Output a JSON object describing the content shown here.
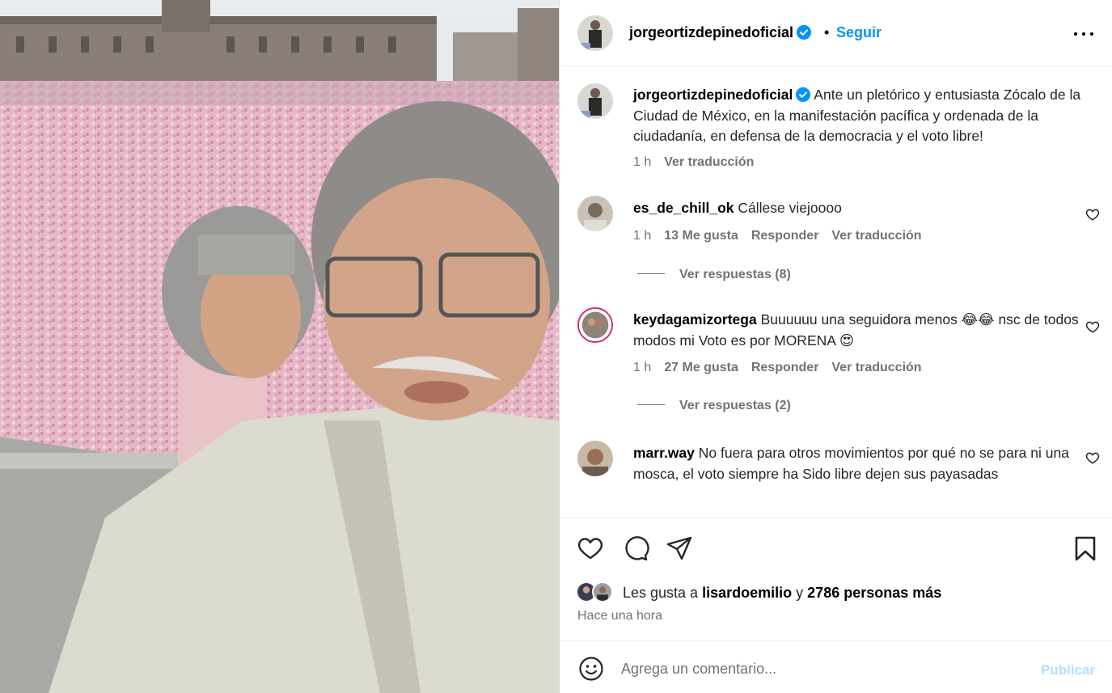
{
  "post": {
    "author": "jorgeortizdepinedoficial",
    "follow_label": "Seguir",
    "separator": "•",
    "more_icon": "more-options-icon",
    "caption": "Ante un pletórico y entusiasta Zócalo de la Ciudad de México, en la manifestación pacífica y ordenada de la ciudadanía, en defensa de la democracia y el voto libre!",
    "caption_time": "1 h",
    "caption_translate": "Ver traducción"
  },
  "comments": [
    {
      "username": "es_de_chill_ok",
      "text": "Cállese viejoooo",
      "time": "1 h",
      "likes": "13 Me gusta",
      "reply": "Responder",
      "translate": "Ver traducción",
      "replies": "Ver respuestas (8)"
    },
    {
      "username": "keydagamizortega",
      "text": "Buuuuuu una seguidora menos 😂😂 nsc de todos modos mi Voto es por MORENA 😍",
      "time": "1 h",
      "likes": "27 Me gusta",
      "reply": "Responder",
      "translate": "Ver traducción",
      "replies": "Ver respuestas (2)"
    },
    {
      "username": "marr.way",
      "text": "No fuera para otros movimientos por qué no se para ni una mosca, el voto siempre ha Sido libre dejen sus payasadas"
    }
  ],
  "actions": {
    "like_icon": "heart-icon",
    "comment_icon": "comment-icon",
    "share_icon": "share-icon",
    "save_icon": "bookmark-icon"
  },
  "likes": {
    "prefix": "Les gusta a",
    "user": "lisardoemilio",
    "joiner": "y",
    "count_text": "2786 personas más"
  },
  "timestamp": "Hace una hora",
  "add_comment": {
    "placeholder": "Agrega un comentario...",
    "publish_label": "Publicar"
  },
  "colors": {
    "accent": "#0095f6",
    "publish_disabled": "#b2dffc",
    "secondary_text": "#737373"
  }
}
